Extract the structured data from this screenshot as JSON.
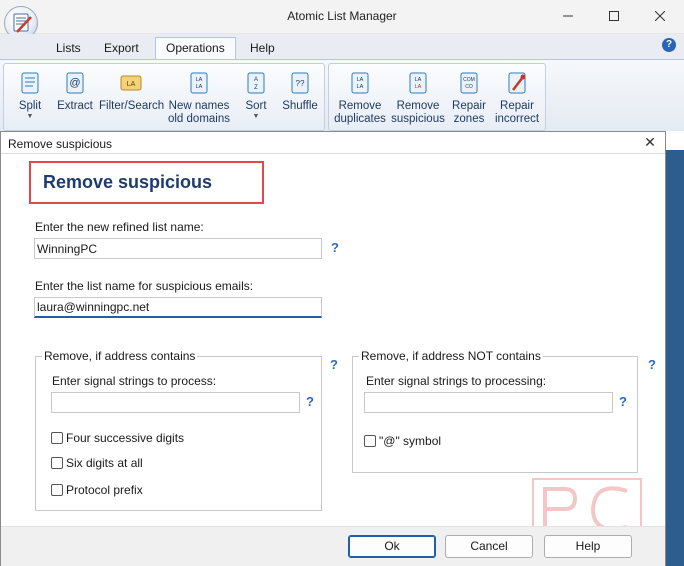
{
  "window": {
    "title": "Atomic List Manager"
  },
  "menu": {
    "items": [
      "Lists",
      "Export",
      "Operations",
      "Help"
    ],
    "active": "Operations"
  },
  "ribbon": {
    "main": [
      {
        "label": "Split",
        "dropdown": true,
        "icon": "scroll-icon"
      },
      {
        "label": "Extract",
        "icon": "at-scroll-icon"
      },
      {
        "label": "Filter/Search",
        "icon": "filter-icon"
      },
      {
        "label": "New names",
        "label2": "old domains",
        "icon": "names-scroll-icon"
      },
      {
        "label": "Sort",
        "dropdown": true,
        "icon": "sort-icon"
      },
      {
        "label": "Shuffle",
        "icon": "shuffle-icon"
      }
    ],
    "clean": [
      {
        "label": "Remove",
        "label2": "duplicates",
        "icon": "duplicates-icon"
      },
      {
        "label": "Remove",
        "label2": "suspicious",
        "icon": "suspicious-icon"
      },
      {
        "label": "Repair",
        "label2": "zones",
        "icon": "zones-icon"
      },
      {
        "label": "Repair",
        "label2": "incorrect",
        "icon": "repair-icon"
      }
    ]
  },
  "dialog": {
    "title": "Remove suspicious",
    "heading": "Remove suspicious",
    "refined_label": "Enter the new refined list name:",
    "refined_value": "WinningPC",
    "suspicious_label": "Enter the list name for suspicious emails:",
    "suspicious_value": "laura@winningpc.net",
    "help_mark": "?",
    "contains": {
      "title": "Remove, if address contains",
      "signal_label": "Enter signal strings to process:",
      "signal_value": "",
      "checks": [
        {
          "label": "Four successive digits",
          "checked": false
        },
        {
          "label": "Six digits at all",
          "checked": false
        },
        {
          "label": "Protocol prefix",
          "checked": false
        }
      ]
    },
    "not_contains": {
      "title": "Remove, if address NOT contains",
      "signal_label": "Enter signal strings to processing:",
      "signal_value": "",
      "checks": [
        {
          "label": "\"@\" symbol",
          "checked": false
        }
      ]
    },
    "buttons": {
      "ok": "Ok",
      "cancel": "Cancel",
      "help": "Help"
    }
  },
  "colors": {
    "accent": "#1f5fb0",
    "heading": "#1c3d6e",
    "highlight_box": "#e0484c",
    "help_mark": "#2a6bc0"
  }
}
